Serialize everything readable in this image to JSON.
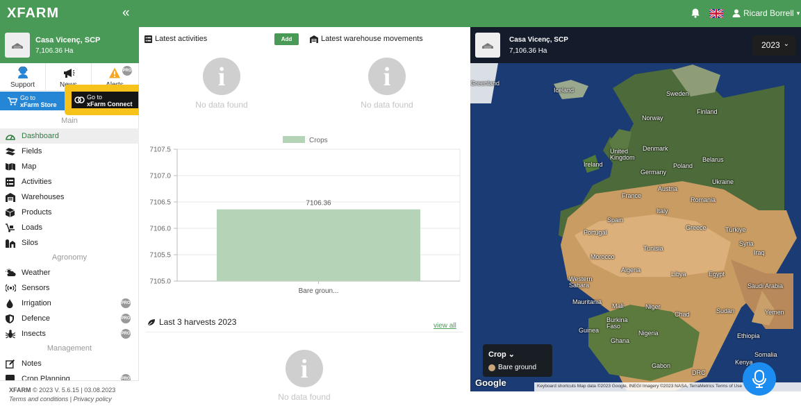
{
  "topbar": {
    "logo": "XFARM",
    "collapse_glyph": "«",
    "user_name": "Ricard Borrell",
    "caret": "▾"
  },
  "farm": {
    "name": "Casa Vicenç, SCP",
    "area": "7,106.36 Ha"
  },
  "quick_links": [
    {
      "label": "Support"
    },
    {
      "label": "News"
    },
    {
      "label": "Alerts",
      "badge": "PRO"
    }
  ],
  "store": {
    "line1": "Go to",
    "line2": "xFarm Store"
  },
  "connect": {
    "line1": "Go to",
    "line2": "xFarm Connect"
  },
  "sections": {
    "main": "Main",
    "agronomy": "Agronomy",
    "management": "Management"
  },
  "nav_main": [
    {
      "label": "Dashboard",
      "icon": "dashboard-icon",
      "active": true
    },
    {
      "label": "Fields",
      "icon": "fields-icon"
    },
    {
      "label": "Map",
      "icon": "map-icon"
    },
    {
      "label": "Activities",
      "icon": "activities-icon"
    },
    {
      "label": "Warehouses",
      "icon": "warehouse-icon"
    },
    {
      "label": "Products",
      "icon": "products-icon"
    },
    {
      "label": "Loads",
      "icon": "loads-icon"
    },
    {
      "label": "Silos",
      "icon": "silos-icon"
    }
  ],
  "nav_agronomy": [
    {
      "label": "Weather",
      "icon": "weather-icon"
    },
    {
      "label": "Sensors",
      "icon": "sensors-icon"
    },
    {
      "label": "Irrigation",
      "icon": "irrigation-icon",
      "badge": "PRO"
    },
    {
      "label": "Defence",
      "icon": "defence-icon",
      "badge": "PRO"
    },
    {
      "label": "Insects",
      "icon": "insects-icon",
      "badge": "PRO"
    }
  ],
  "nav_management": [
    {
      "label": "Notes",
      "icon": "notes-icon"
    },
    {
      "label": "Crop Planning",
      "icon": "crop-planning-icon",
      "badge": "PRO"
    }
  ],
  "footer": {
    "logo": "XFARM",
    "version": "© 2023 V. 5.6.15 | 03.08.2023",
    "terms": "Terms and conditions",
    "sep": "|",
    "privacy": "Privacy policy"
  },
  "activities": {
    "title": "Latest activities",
    "add_label": "Add",
    "empty": "No data found"
  },
  "warehouse": {
    "title": "Latest warehouse movements",
    "empty": "No data found"
  },
  "chart_data": {
    "type": "bar",
    "categories": [
      "Bare groun..."
    ],
    "series": [
      {
        "name": "Crops",
        "values": [
          7106.36
        ]
      }
    ],
    "data_labels": [
      "7106.36"
    ],
    "yticks": [
      "7105.0",
      "7105.5",
      "7106.0",
      "7106.5",
      "7107.0",
      "7107.5"
    ],
    "ylim": [
      7105.0,
      7107.5
    ],
    "title": "",
    "xlabel": "",
    "ylabel": "",
    "grid": true,
    "legend": "top-center",
    "color": "#b4d3b7"
  },
  "harvests": {
    "title": "Last 3 harvests 2023",
    "view_all": "view all",
    "empty": "No data found"
  },
  "map": {
    "farm_name": "Casa Vicenç, SCP",
    "farm_area": "7,106.36 Ha",
    "year": "2023",
    "labels": [
      "Greenland",
      "Iceland",
      "Sweden",
      "Finland",
      "Norway",
      "Denmark",
      "United Kingdom",
      "Belarus",
      "Ireland",
      "Poland",
      "Germany",
      "Ukraine",
      "Austria",
      "France",
      "Romania",
      "Italy",
      "Spain",
      "Portugal",
      "Greece",
      "Türkiye",
      "Tunisia",
      "Syria",
      "Iraq",
      "Morocco",
      "Algeria",
      "Libya",
      "Egypt",
      "Western Sahara",
      "Saudi Arabia",
      "Mauritania",
      "Mali",
      "Niger",
      "Sudan",
      "Chad",
      "Yemen",
      "Burkina Faso",
      "Guinea",
      "Nigeria",
      "Ethiopia",
      "Ghana",
      "Somalia",
      "Kenya",
      "Gabon",
      "DRC"
    ],
    "legend_title": "Crop",
    "legend_chevron": "⌄",
    "legend_item": "Bare ground",
    "legend_color": "#c9a57a",
    "google": "Google",
    "attribution": "Keyboard shortcuts   Map data ©2023 Google, INEGI Imagery ©2023 NASA, TerraMetrics   Terms of Use"
  }
}
